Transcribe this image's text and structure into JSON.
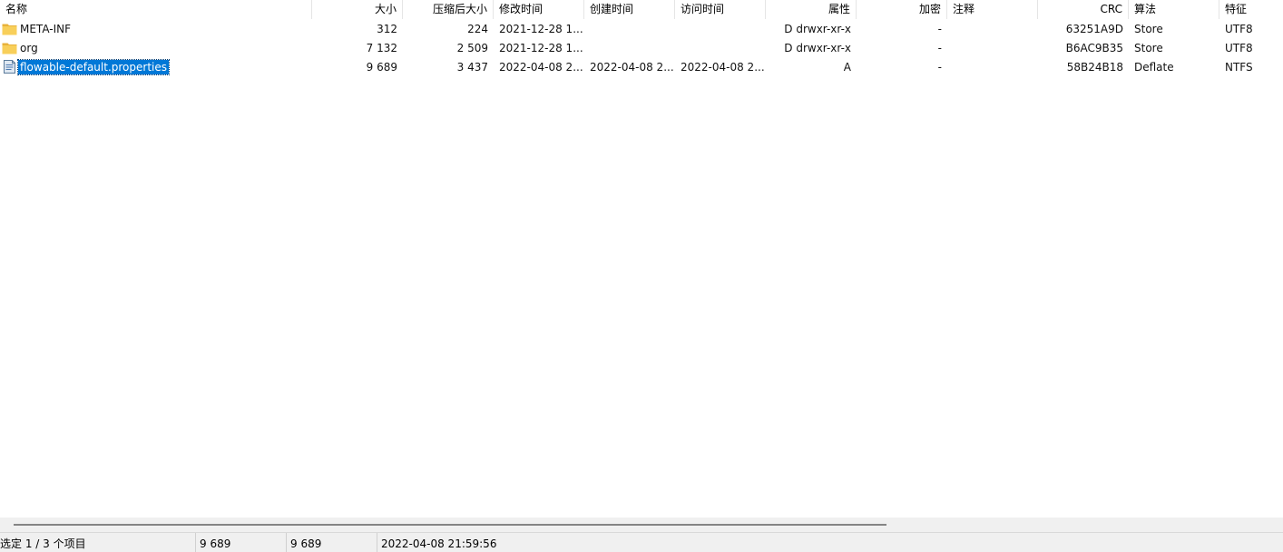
{
  "columns": {
    "name": "名称",
    "size": "大小",
    "packed": "压缩后大小",
    "modified": "修改时间",
    "created": "创建时间",
    "accessed": "访问时间",
    "attributes": "属性",
    "encrypted": "加密",
    "comment": "注释",
    "crc": "CRC",
    "method": "算法",
    "characteristics": "特征"
  },
  "rows": [
    {
      "icon": "folder-icon",
      "name": "META-INF",
      "size": "312",
      "packed": "224",
      "modified": "2021-12-28 1...",
      "created": "",
      "accessed": "",
      "attributes": "D drwxr-xr-x",
      "encrypted": "-",
      "comment": "",
      "crc": "63251A9D",
      "method": "Store",
      "characteristics": "UTF8"
    },
    {
      "icon": "folder-icon",
      "name": "org",
      "size": "7 132",
      "packed": "2 509",
      "modified": "2021-12-28 1...",
      "created": "",
      "accessed": "",
      "attributes": "D drwxr-xr-x",
      "encrypted": "-",
      "comment": "",
      "crc": "B6AC9B35",
      "method": "Store",
      "characteristics": "UTF8"
    },
    {
      "icon": "file-icon",
      "name": "flowable-default.properties",
      "size": "9 689",
      "packed": "3 437",
      "modified": "2022-04-08 2...",
      "created": "2022-04-08 2...",
      "accessed": "2022-04-08 2...",
      "attributes": "A",
      "encrypted": "-",
      "comment": "",
      "crc": "58B24B18",
      "method": "Deflate",
      "characteristics": "NTFS",
      "selected": true
    }
  ],
  "status": {
    "selection": "选定 1 / 3 个项目",
    "size": "9 689",
    "packed": "9 689",
    "modified": "2022-04-08 21:59:56"
  },
  "colors": {
    "selection": "#0078d7",
    "folder": "#f5c342",
    "statusbar": "#f0f0f0"
  }
}
